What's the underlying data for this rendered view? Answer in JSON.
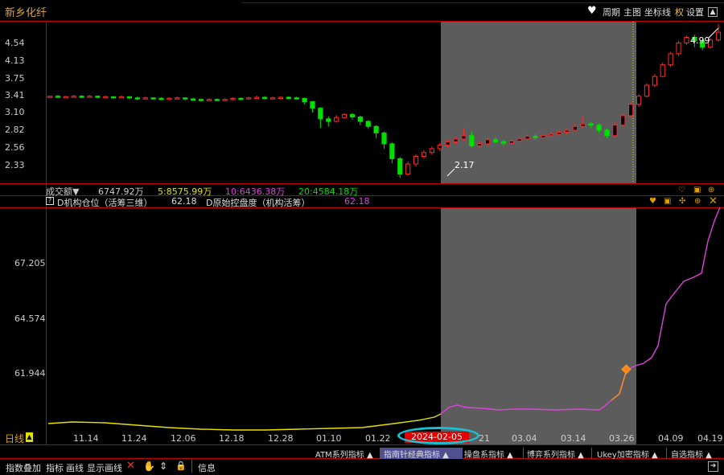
{
  "title": "新乡化纤",
  "toolbar": {
    "period": "周期",
    "main_chart": "主图",
    "coord_line": "坐标线",
    "quan": "权",
    "settings": "设置"
  },
  "price_axis": [
    "4.54",
    "4.13",
    "3.75",
    "3.41",
    "3.10",
    "2.82",
    "2.56",
    "2.33"
  ],
  "annotations": {
    "high": "4.99",
    "low": "2.17"
  },
  "volume": {
    "label": "成交额",
    "total": "6747.92万",
    "ma5": "5:8575.99万",
    "ma10": "10:6436.38万",
    "ma20": "20:4584.18万"
  },
  "indicator": {
    "name": "D机构仓位（活筹三维）",
    "value1": "62.18",
    "sub_name": "D原始控盘度（机构活筹）",
    "value2": "62.18"
  },
  "indicator_axis": [
    "67.205",
    "64.574",
    "61.944"
  ],
  "date_axis": {
    "period_label": "日线",
    "dates": [
      "11.14",
      "11.24",
      "12.06",
      "12.18",
      "12.28",
      "01.10",
      "01.22",
      "03.04",
      "03.14",
      "03.26",
      "04.09",
      "04.19"
    ],
    "highlight_date": "2024-02-05",
    "partial_date": "21"
  },
  "indicator_tabs": [
    "ATM系列指标",
    "指南针经典指标",
    "操盘系指标",
    "博弈系列指标",
    "Ukey加密指标",
    "自选指标"
  ],
  "bottom_toolbar": {
    "items": [
      "指数叠加",
      "指标",
      "画线",
      "显示画线"
    ],
    "info": "信息"
  },
  "colors": {
    "up": "#ff2a2a",
    "down": "#00e000",
    "accent": "#c00000",
    "magenta": "#e040e0",
    "yellow": "#e8e000",
    "gray_region": "#606060"
  },
  "chart_data": {
    "type": "candlestick",
    "candles": [
      [
        3.38,
        3.4,
        3.36,
        3.41
      ],
      [
        3.4,
        3.38,
        3.37,
        3.42
      ],
      [
        3.38,
        3.39,
        3.36,
        3.41
      ],
      [
        3.39,
        3.4,
        3.37,
        3.42
      ],
      [
        3.4,
        3.39,
        3.37,
        3.42
      ],
      [
        3.39,
        3.4,
        3.38,
        3.42
      ],
      [
        3.4,
        3.38,
        3.36,
        3.41
      ],
      [
        3.38,
        3.39,
        3.36,
        3.41
      ],
      [
        3.39,
        3.38,
        3.36,
        3.4
      ],
      [
        3.38,
        3.39,
        3.37,
        3.41
      ],
      [
        3.39,
        3.37,
        3.35,
        3.4
      ],
      [
        3.37,
        3.36,
        3.33,
        3.39
      ],
      [
        3.36,
        3.37,
        3.34,
        3.39
      ],
      [
        3.37,
        3.36,
        3.34,
        3.38
      ],
      [
        3.36,
        3.35,
        3.33,
        3.38
      ],
      [
        3.35,
        3.36,
        3.33,
        3.38
      ],
      [
        3.36,
        3.37,
        3.34,
        3.39
      ],
      [
        3.37,
        3.35,
        3.33,
        3.38
      ],
      [
        3.35,
        3.34,
        3.32,
        3.37
      ],
      [
        3.34,
        3.33,
        3.3,
        3.36
      ],
      [
        3.33,
        3.34,
        3.31,
        3.36
      ],
      [
        3.34,
        3.33,
        3.31,
        3.36
      ],
      [
        3.33,
        3.34,
        3.31,
        3.36
      ],
      [
        3.34,
        3.36,
        3.32,
        3.38
      ],
      [
        3.36,
        3.35,
        3.33,
        3.38
      ],
      [
        3.35,
        3.37,
        3.34,
        3.39
      ],
      [
        3.37,
        3.38,
        3.35,
        3.41
      ],
      [
        3.38,
        3.36,
        3.34,
        3.4
      ],
      [
        3.36,
        3.37,
        3.34,
        3.39
      ],
      [
        3.37,
        3.38,
        3.35,
        3.4
      ],
      [
        3.38,
        3.37,
        3.35,
        3.4
      ],
      [
        3.37,
        3.36,
        3.34,
        3.39
      ],
      [
        3.36,
        3.3,
        3.25,
        3.37
      ],
      [
        3.3,
        3.18,
        3.1,
        3.31
      ],
      [
        3.18,
        3.0,
        2.86,
        3.2
      ],
      [
        3.0,
        2.96,
        2.88,
        3.04
      ],
      [
        2.96,
        3.02,
        2.94,
        3.06
      ],
      [
        3.02,
        3.07,
        3.0,
        3.09
      ],
      [
        3.07,
        3.03,
        2.99,
        3.09
      ],
      [
        3.03,
        2.96,
        2.9,
        3.05
      ],
      [
        2.96,
        2.88,
        2.84,
        2.98
      ],
      [
        2.88,
        2.78,
        2.7,
        2.9
      ],
      [
        2.78,
        2.62,
        2.55,
        2.8
      ],
      [
        2.62,
        2.42,
        2.36,
        2.64
      ],
      [
        2.42,
        2.22,
        2.17,
        2.44
      ],
      [
        2.22,
        2.35,
        2.2,
        2.38
      ],
      [
        2.35,
        2.45,
        2.32,
        2.48
      ],
      [
        2.45,
        2.5,
        2.42,
        2.53
      ],
      [
        2.5,
        2.55,
        2.47,
        2.58
      ],
      [
        2.55,
        2.6,
        2.52,
        2.63
      ],
      [
        2.6,
        2.65,
        2.57,
        2.68
      ],
      [
        2.65,
        2.69,
        2.62,
        2.72
      ],
      [
        2.69,
        2.74,
        2.66,
        2.86
      ],
      [
        2.74,
        2.59,
        2.56,
        2.8
      ],
      [
        2.59,
        2.62,
        2.56,
        2.66
      ],
      [
        2.62,
        2.68,
        2.59,
        2.71
      ],
      [
        2.68,
        2.65,
        2.62,
        2.71
      ],
      [
        2.65,
        2.63,
        2.6,
        2.68
      ],
      [
        2.63,
        2.66,
        2.61,
        2.7
      ],
      [
        2.66,
        2.69,
        2.63,
        2.72
      ],
      [
        2.69,
        2.73,
        2.66,
        2.76
      ],
      [
        2.73,
        2.71,
        2.68,
        2.76
      ],
      [
        2.71,
        2.74,
        2.69,
        2.77
      ],
      [
        2.74,
        2.76,
        2.71,
        2.79
      ],
      [
        2.76,
        2.79,
        2.73,
        2.82
      ],
      [
        2.79,
        2.82,
        2.76,
        2.85
      ],
      [
        2.82,
        2.88,
        2.8,
        2.92
      ],
      [
        2.88,
        2.92,
        2.85,
        3.04
      ],
      [
        2.92,
        2.9,
        2.85,
        2.95
      ],
      [
        2.9,
        2.82,
        2.78,
        2.93
      ],
      [
        2.82,
        2.74,
        2.7,
        2.85
      ],
      [
        2.74,
        2.9,
        2.72,
        2.94
      ],
      [
        2.9,
        3.05,
        2.88,
        3.08
      ],
      [
        3.05,
        3.25,
        3.02,
        3.28
      ],
      [
        3.25,
        3.4,
        3.2,
        3.44
      ],
      [
        3.4,
        3.62,
        3.38,
        3.66
      ],
      [
        3.62,
        3.8,
        3.58,
        3.85
      ],
      [
        3.8,
        4.05,
        3.78,
        4.1
      ],
      [
        4.05,
        4.3,
        4.0,
        4.35
      ],
      [
        4.3,
        4.55,
        4.25,
        4.6
      ],
      [
        4.55,
        4.68,
        4.5,
        4.72
      ],
      [
        4.68,
        4.6,
        4.45,
        4.74
      ],
      [
        4.6,
        4.45,
        4.38,
        4.65
      ],
      [
        4.45,
        4.62,
        4.42,
        4.66
      ],
      [
        4.62,
        4.8,
        4.58,
        4.99
      ]
    ]
  }
}
